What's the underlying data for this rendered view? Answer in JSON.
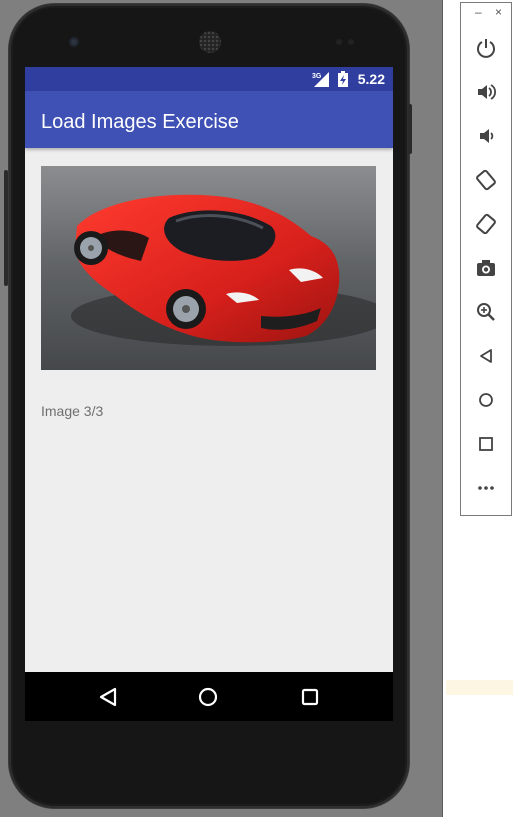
{
  "app": {
    "title": "Load Images Exercise",
    "caption": "Image 3/3"
  },
  "status_bar": {
    "network": "3G",
    "time": "5.22"
  },
  "image": {
    "subject": "red sports car"
  },
  "nav_bar": {
    "back_icon": "back-triangle-icon",
    "home_icon": "home-circle-icon",
    "recents_icon": "recents-square-icon"
  },
  "emulator_toolbar": {
    "minimize_label": "–",
    "close_label": "×",
    "buttons": [
      "power-icon",
      "volume-up-icon",
      "volume-down-icon",
      "rotate-left-icon",
      "rotate-right-icon",
      "camera-icon",
      "zoom-icon",
      "back-icon",
      "home-icon",
      "overview-icon",
      "more-icon"
    ]
  },
  "colors": {
    "status_bar": "#303f9f",
    "app_bar": "#3f51b5",
    "screen_bg": "#eeeeee",
    "car_red": "#d8201c"
  }
}
